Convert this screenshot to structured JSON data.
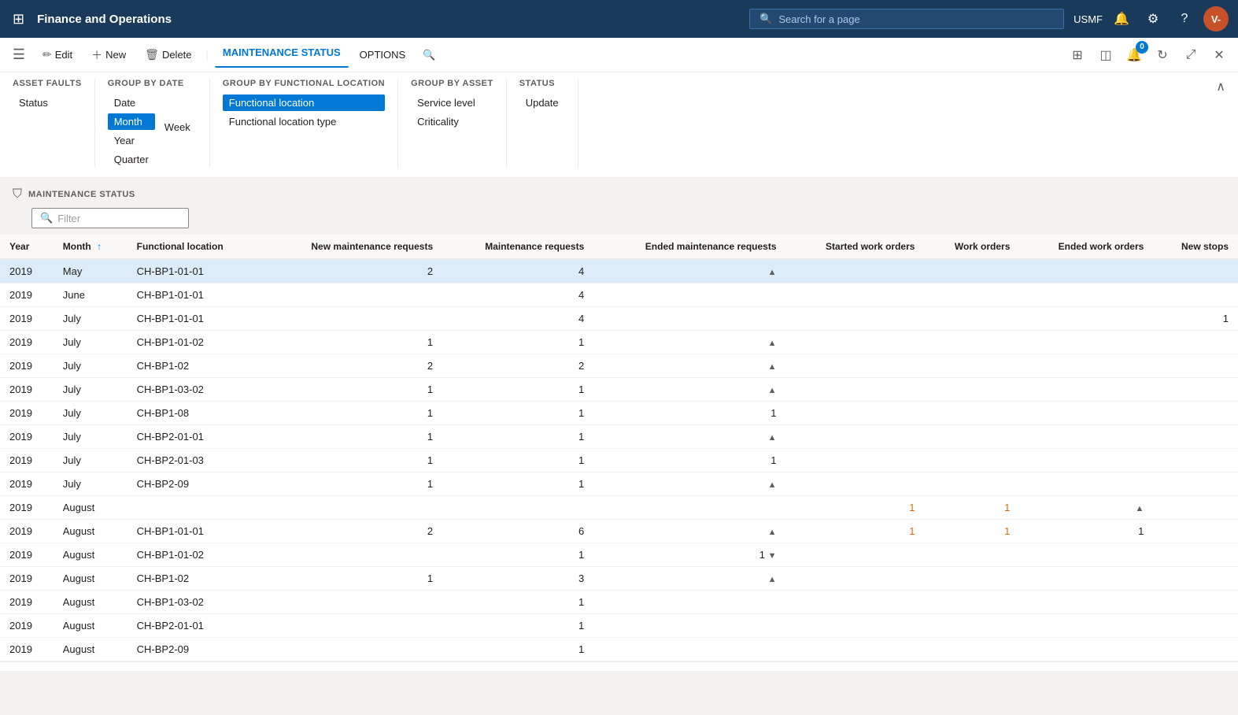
{
  "app": {
    "title": "Finance and Operations",
    "search_placeholder": "Search for a page",
    "user": "USMF",
    "avatar": "V-"
  },
  "commandbar": {
    "edit_label": "Edit",
    "new_label": "New",
    "delete_label": "Delete",
    "tab_maintenance": "MAINTENANCE STATUS",
    "tab_options": "OPTIONS"
  },
  "ribbon": {
    "asset_faults_title": "ASSET FAULTS",
    "asset_faults_items": [
      {
        "label": "Status",
        "active": false
      }
    ],
    "group_by_date_title": "GROUP BY DATE",
    "group_by_date_items": [
      {
        "label": "Date",
        "active": false
      },
      {
        "label": "Month",
        "active": true
      },
      {
        "label": "Year",
        "active": false
      },
      {
        "label": "Week",
        "active": false
      },
      {
        "label": "Quarter",
        "active": false
      }
    ],
    "group_by_functional_title": "GROUP BY FUNCTIONAL LOCATION",
    "group_by_functional_items": [
      {
        "label": "Functional location",
        "active": true
      },
      {
        "label": "Functional location type",
        "active": false
      }
    ],
    "group_by_asset_title": "GROUP BY ASSET",
    "group_by_asset_items": [
      {
        "label": "Service level",
        "active": false
      },
      {
        "label": "Criticality",
        "active": false
      }
    ],
    "status_title": "STATUS",
    "status_items": [
      {
        "label": "Update",
        "active": false
      }
    ]
  },
  "main": {
    "section_label": "MAINTENANCE STATUS",
    "filter_placeholder": "Filter"
  },
  "table": {
    "columns": [
      "Year",
      "Month",
      "Functional location",
      "New maintenance requests",
      "Maintenance requests",
      "Ended maintenance requests",
      "Started work orders",
      "Work orders",
      "Ended work orders",
      "New stops"
    ],
    "rows": [
      {
        "year": "2019",
        "month": "May",
        "location": "CH-BP1-01-01",
        "new_mr": "2",
        "mr": "4",
        "ended_mr": "▲",
        "started_wo": "",
        "wo": "",
        "ended_wo": "",
        "new_stops": "",
        "selected": true
      },
      {
        "year": "2019",
        "month": "June",
        "location": "CH-BP1-01-01",
        "new_mr": "",
        "mr": "4",
        "ended_mr": "",
        "started_wo": "",
        "wo": "",
        "ended_wo": "",
        "new_stops": ""
      },
      {
        "year": "2019",
        "month": "July",
        "location": "CH-BP1-01-01",
        "new_mr": "",
        "mr": "4",
        "ended_mr": "",
        "started_wo": "",
        "wo": "",
        "ended_wo": "",
        "new_stops": "1"
      },
      {
        "year": "2019",
        "month": "July",
        "location": "CH-BP1-01-02",
        "new_mr": "1",
        "mr": "1",
        "ended_mr": "▲",
        "started_wo": "",
        "wo": "",
        "ended_wo": "",
        "new_stops": ""
      },
      {
        "year": "2019",
        "month": "July",
        "location": "CH-BP1-02",
        "new_mr": "2",
        "mr": "2",
        "ended_mr": "▲",
        "started_wo": "",
        "wo": "",
        "ended_wo": "",
        "new_stops": ""
      },
      {
        "year": "2019",
        "month": "July",
        "location": "CH-BP1-03-02",
        "new_mr": "1",
        "mr": "1",
        "ended_mr": "▲",
        "started_wo": "",
        "wo": "",
        "ended_wo": "",
        "new_stops": ""
      },
      {
        "year": "2019",
        "month": "July",
        "location": "CH-BP1-08",
        "new_mr": "1",
        "mr": "1",
        "ended_mr": "1",
        "started_wo": "",
        "wo": "",
        "ended_wo": "",
        "new_stops": ""
      },
      {
        "year": "2019",
        "month": "July",
        "location": "CH-BP2-01-01",
        "new_mr": "1",
        "mr": "1",
        "ended_mr": "▲",
        "started_wo": "",
        "wo": "",
        "ended_wo": "",
        "new_stops": ""
      },
      {
        "year": "2019",
        "month": "July",
        "location": "CH-BP2-01-03",
        "new_mr": "1",
        "mr": "1",
        "ended_mr": "1",
        "started_wo": "",
        "wo": "",
        "ended_wo": "",
        "new_stops": ""
      },
      {
        "year": "2019",
        "month": "July",
        "location": "CH-BP2-09",
        "new_mr": "1",
        "mr": "1",
        "ended_mr": "▲",
        "started_wo": "",
        "wo": "",
        "ended_wo": "",
        "new_stops": ""
      },
      {
        "year": "2019",
        "month": "August",
        "location": "",
        "new_mr": "",
        "mr": "",
        "ended_mr": "",
        "started_wo": "1",
        "wo": "1",
        "ended_wo": "▲",
        "new_stops": "",
        "orange_wo": true
      },
      {
        "year": "2019",
        "month": "August",
        "location": "CH-BP1-01-01",
        "new_mr": "2",
        "mr": "6",
        "ended_mr": "▲",
        "started_wo": "1",
        "wo": "1",
        "ended_wo": "1",
        "new_stops": "",
        "orange_wo": true
      },
      {
        "year": "2019",
        "month": "August",
        "location": "CH-BP1-01-02",
        "new_mr": "",
        "mr": "1",
        "ended_mr": "1 ▼",
        "started_wo": "",
        "wo": "",
        "ended_wo": "",
        "new_stops": ""
      },
      {
        "year": "2019",
        "month": "August",
        "location": "CH-BP1-02",
        "new_mr": "1",
        "mr": "3",
        "ended_mr": "▲",
        "started_wo": "",
        "wo": "",
        "ended_wo": "",
        "new_stops": ""
      },
      {
        "year": "2019",
        "month": "August",
        "location": "CH-BP1-03-02",
        "new_mr": "",
        "mr": "1",
        "ended_mr": "",
        "started_wo": "",
        "wo": "",
        "ended_wo": "",
        "new_stops": ""
      },
      {
        "year": "2019",
        "month": "August",
        "location": "CH-BP2-01-01",
        "new_mr": "",
        "mr": "1",
        "ended_mr": "",
        "started_wo": "",
        "wo": "",
        "ended_wo": "",
        "new_stops": ""
      },
      {
        "year": "2019",
        "month": "August",
        "location": "CH-BP2-09",
        "new_mr": "",
        "mr": "1",
        "ended_mr": "",
        "started_wo": "",
        "wo": "",
        "ended_wo": "",
        "new_stops": ""
      }
    ]
  }
}
